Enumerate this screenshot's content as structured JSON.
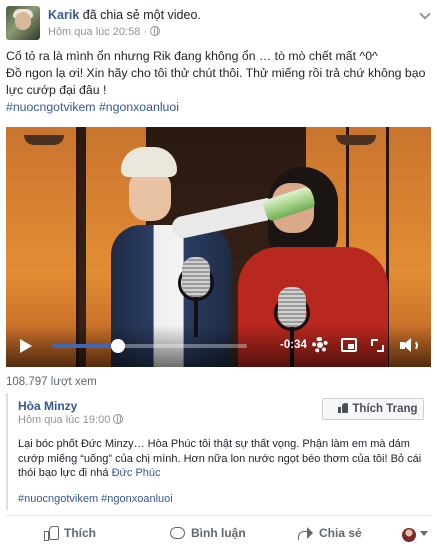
{
  "post": {
    "author": "Karik",
    "action": "đã chia sẻ một video.",
    "time": "Hôm qua lúc 20:58",
    "separator": "·",
    "caption": {
      "line1": "Cố tỏ ra là mình ổn nhưng Rik đang không ổn … tò mò chết mất ^0^",
      "line2": "Đồ ngon lạ ơi! Xin hãy cho tôi thử chút thôi. Thử miếng rồi trả chứ không bạo lực cướp đại đâu !",
      "hashtags": "#nuocngotvikem #ngonxoanluoi"
    }
  },
  "video": {
    "time_remaining": "-0:34",
    "progress": 0.34
  },
  "views": "108.797 lượt xem",
  "shared_post": {
    "name": "Hòa Minzy",
    "time": "Hôm qua lúc 19:00",
    "like_page_label": "Thích Trang",
    "text_before_tag": "Lại bóc phốt Đức Minzy… Hòa Phúc tôi thật sự thất vọng. Phận làm em mà dám cướp miếng “uống” của chị mình. Hơn nữa lon nước ngọt béo thơm của tôi! Bỏ cái thói bạo lực đi nhá ",
    "tagged": "Đức Phúc",
    "hashtags": "#nuocngotvikem #ngonxoanluoi"
  },
  "actions": {
    "like": "Thích",
    "comment": "Bình luận",
    "share": "Chia sẻ"
  }
}
